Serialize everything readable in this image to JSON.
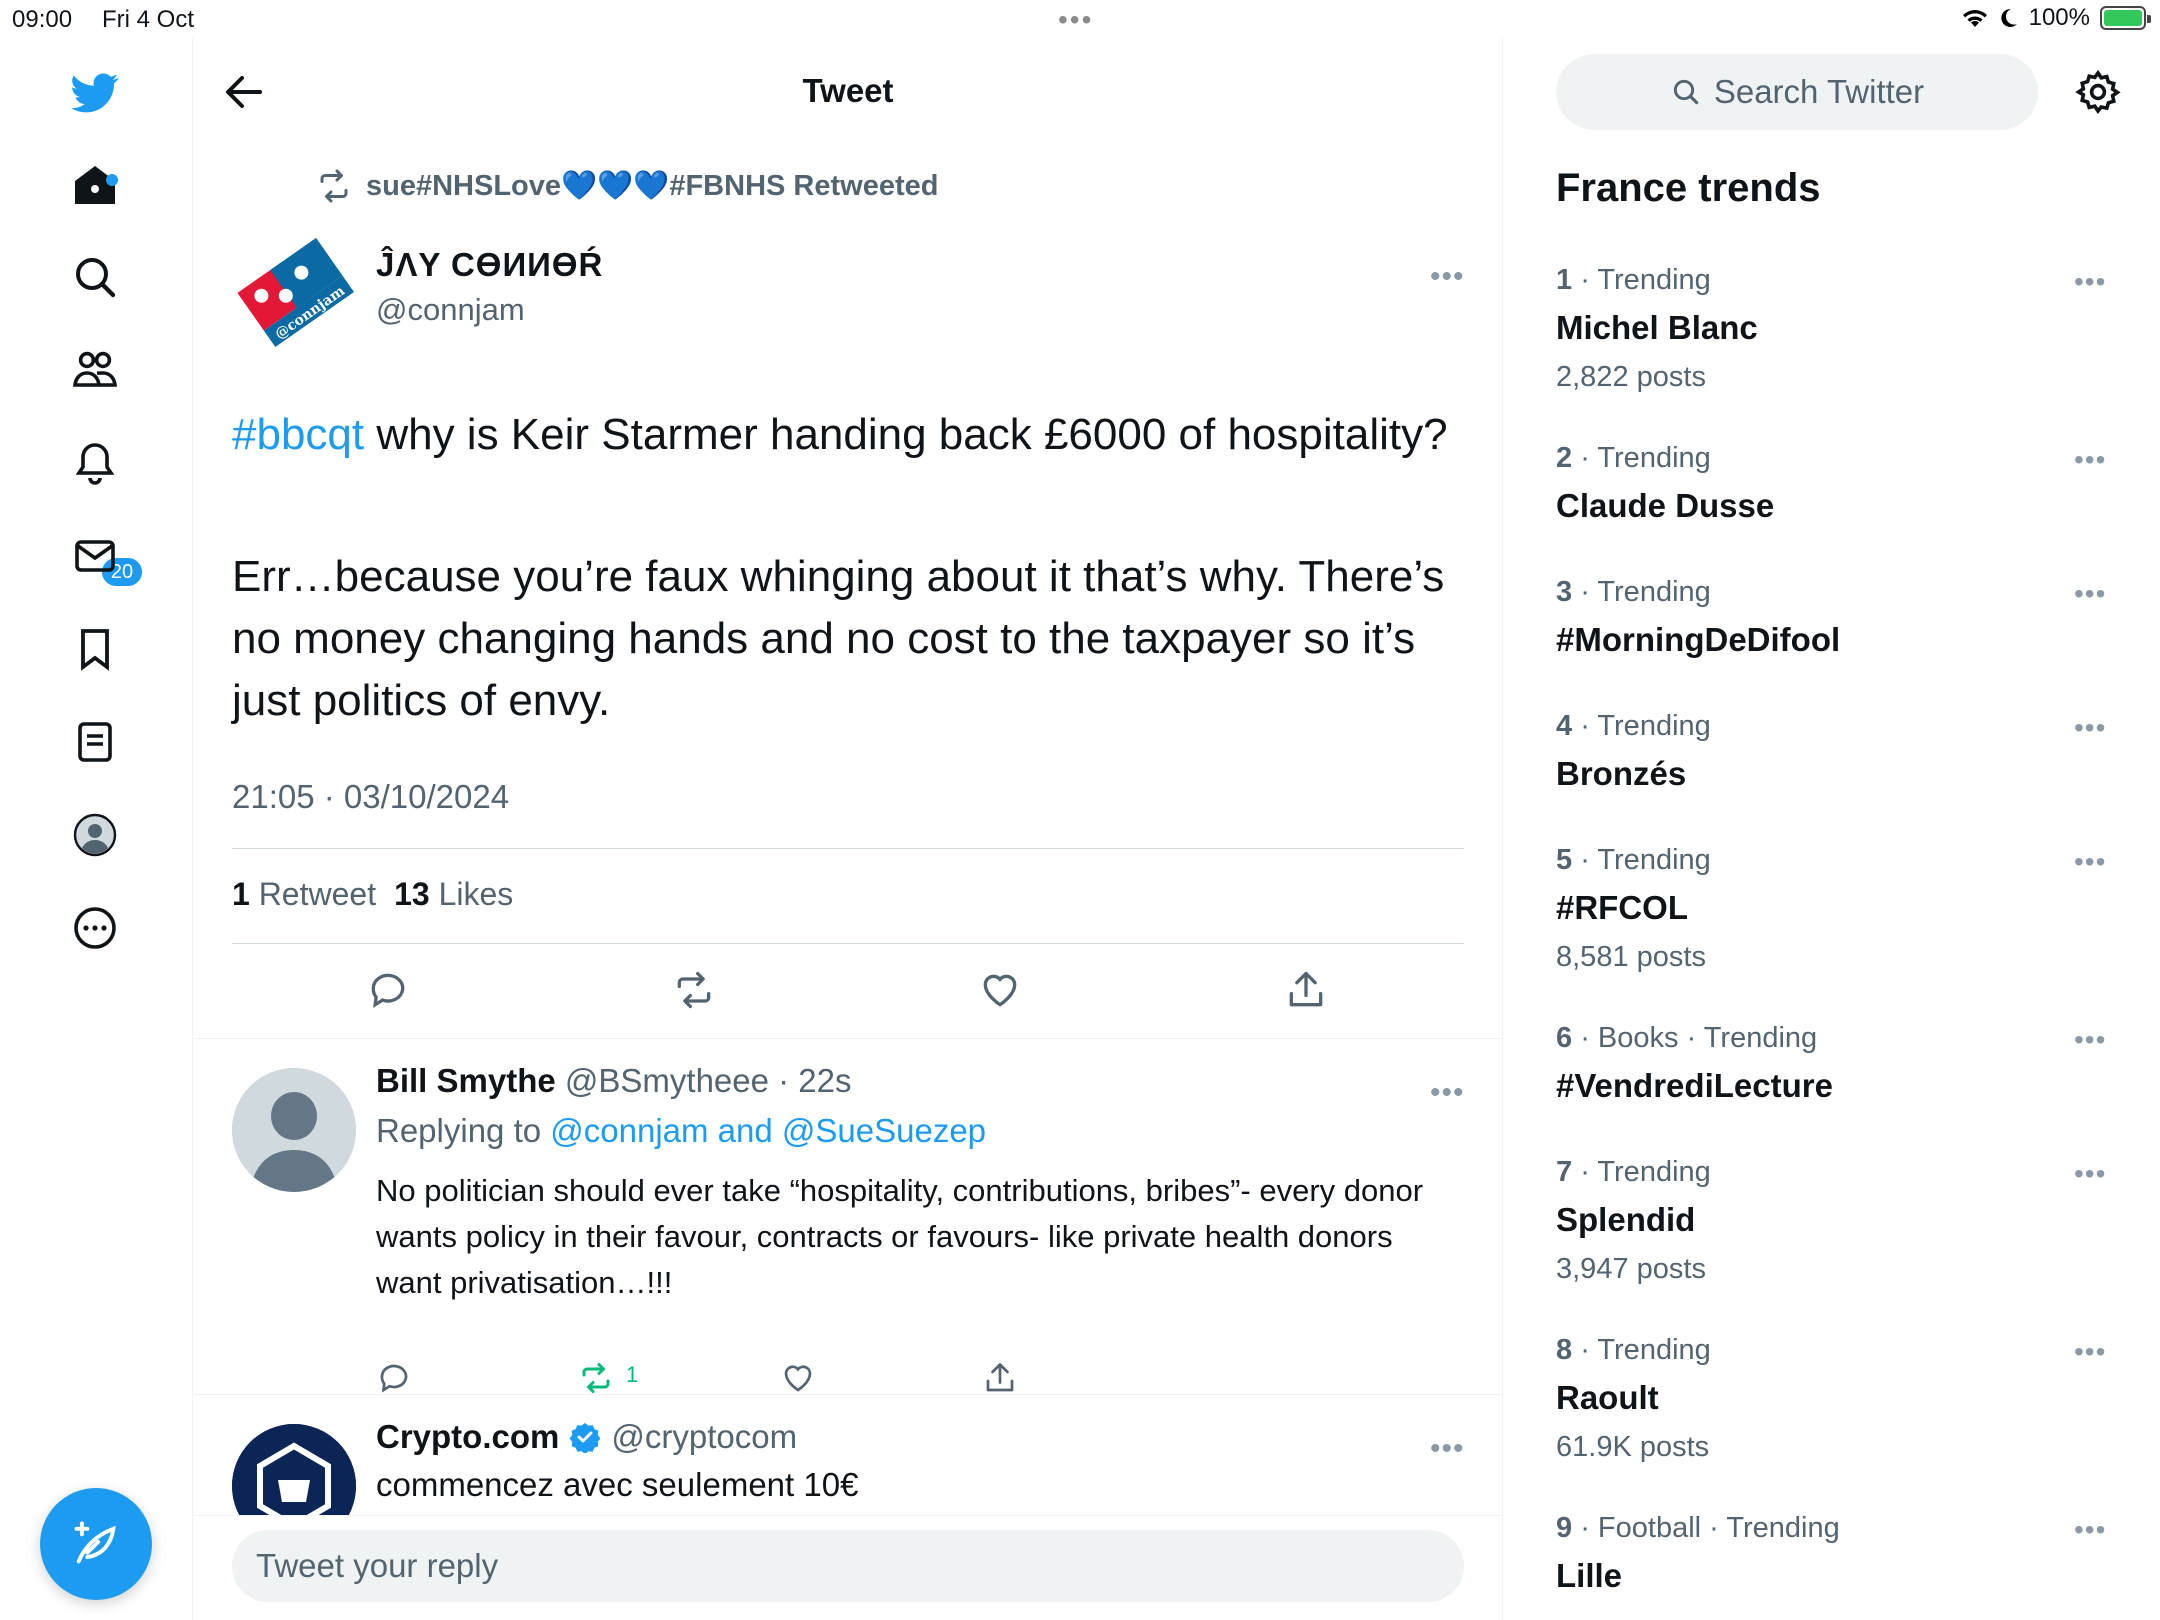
{
  "status_bar": {
    "time": "09:00",
    "date": "Fri 4 Oct",
    "battery": "100%"
  },
  "nav": {
    "notifications_badge": "20"
  },
  "header": {
    "title": "Tweet"
  },
  "tweet": {
    "retweeted_by": "sue#NHSLove💙💙💙#FBNHS Retweeted",
    "author_name": "ĴΛY ϹϴИИϴŔ",
    "author_handle": "@connjam",
    "avatar_text": "@ connjam",
    "hashtag": "#bbcqt",
    "text_line1": " why is Keir Starmer handing back £6000 of hospitality?",
    "text_para2": "Err…because you’re faux whinging about it that’s why. There’s no money changing hands and no cost to the taxpayer so it’s just politics of envy.",
    "timestamp": "21:05 · 03/10/2024",
    "retweet_count": "1",
    "retweet_label": "Retweet",
    "like_count": "13",
    "like_label": "Likes"
  },
  "reply": {
    "author_name": "Bill Smythe",
    "author_handle": "@BSmytheee",
    "age": " · 22s",
    "replying_prefix": "Replying to ",
    "replying_to": "@connjam and @SueSuezep",
    "text": "No politician should ever take “hospitality, contributions, bribes”- every donor wants policy in their favour, contracts or favours- like private health donors want privatisation…!!!",
    "retweet_count": "1"
  },
  "promoted": {
    "author_name": "Crypto.com",
    "author_handle": "@cryptocom",
    "text": "commencez avec seulement 10€"
  },
  "reply_bar": {
    "placeholder": "Tweet your reply"
  },
  "sidebar": {
    "search_placeholder": "Search Twitter",
    "trends_title": "France trends",
    "trends": [
      {
        "rank": "1",
        "context": "Trending",
        "name": "Michel Blanc",
        "posts": "2,822 posts"
      },
      {
        "rank": "2",
        "context": "Trending",
        "name": "Claude Dusse",
        "posts": ""
      },
      {
        "rank": "3",
        "context": "Trending",
        "name": "#MorningDeDifool",
        "posts": ""
      },
      {
        "rank": "4",
        "context": "Trending",
        "name": "Bronzés",
        "posts": ""
      },
      {
        "rank": "5",
        "context": "Trending",
        "name": "#RFCOL",
        "posts": "8,581 posts"
      },
      {
        "rank": "6",
        "context": "Books · Trending",
        "name": "#VendrediLecture",
        "posts": ""
      },
      {
        "rank": "7",
        "context": "Trending",
        "name": "Splendid",
        "posts": "3,947 posts"
      },
      {
        "rank": "8",
        "context": "Trending",
        "name": "Raoult",
        "posts": "61.9K posts"
      },
      {
        "rank": "9",
        "context": "Football · Trending",
        "name": "Lille",
        "posts": ""
      }
    ]
  },
  "colors": {
    "accent": "#1d9bf0",
    "retweet_green": "#00ba7c",
    "muted": "#536471"
  }
}
